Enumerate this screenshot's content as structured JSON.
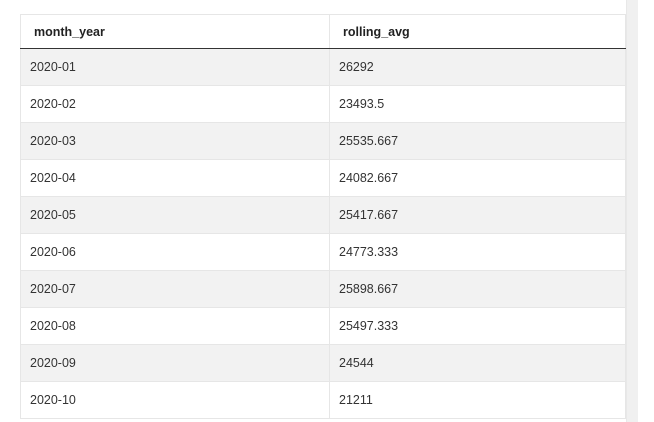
{
  "table": {
    "columns": [
      "month_year",
      "rolling_avg"
    ],
    "rows": [
      [
        "2020-01",
        "26292"
      ],
      [
        "2020-02",
        "23493.5"
      ],
      [
        "2020-03",
        "25535.667"
      ],
      [
        "2020-04",
        "24082.667"
      ],
      [
        "2020-05",
        "25417.667"
      ],
      [
        "2020-06",
        "24773.333"
      ],
      [
        "2020-07",
        "25898.667"
      ],
      [
        "2020-08",
        "25497.333"
      ],
      [
        "2020-09",
        "24544"
      ],
      [
        "2020-10",
        "21211"
      ]
    ]
  },
  "colors": {
    "stripe": "#f2f2f2",
    "header_rule": "#333333",
    "cell_border": "#e6e6e6"
  }
}
